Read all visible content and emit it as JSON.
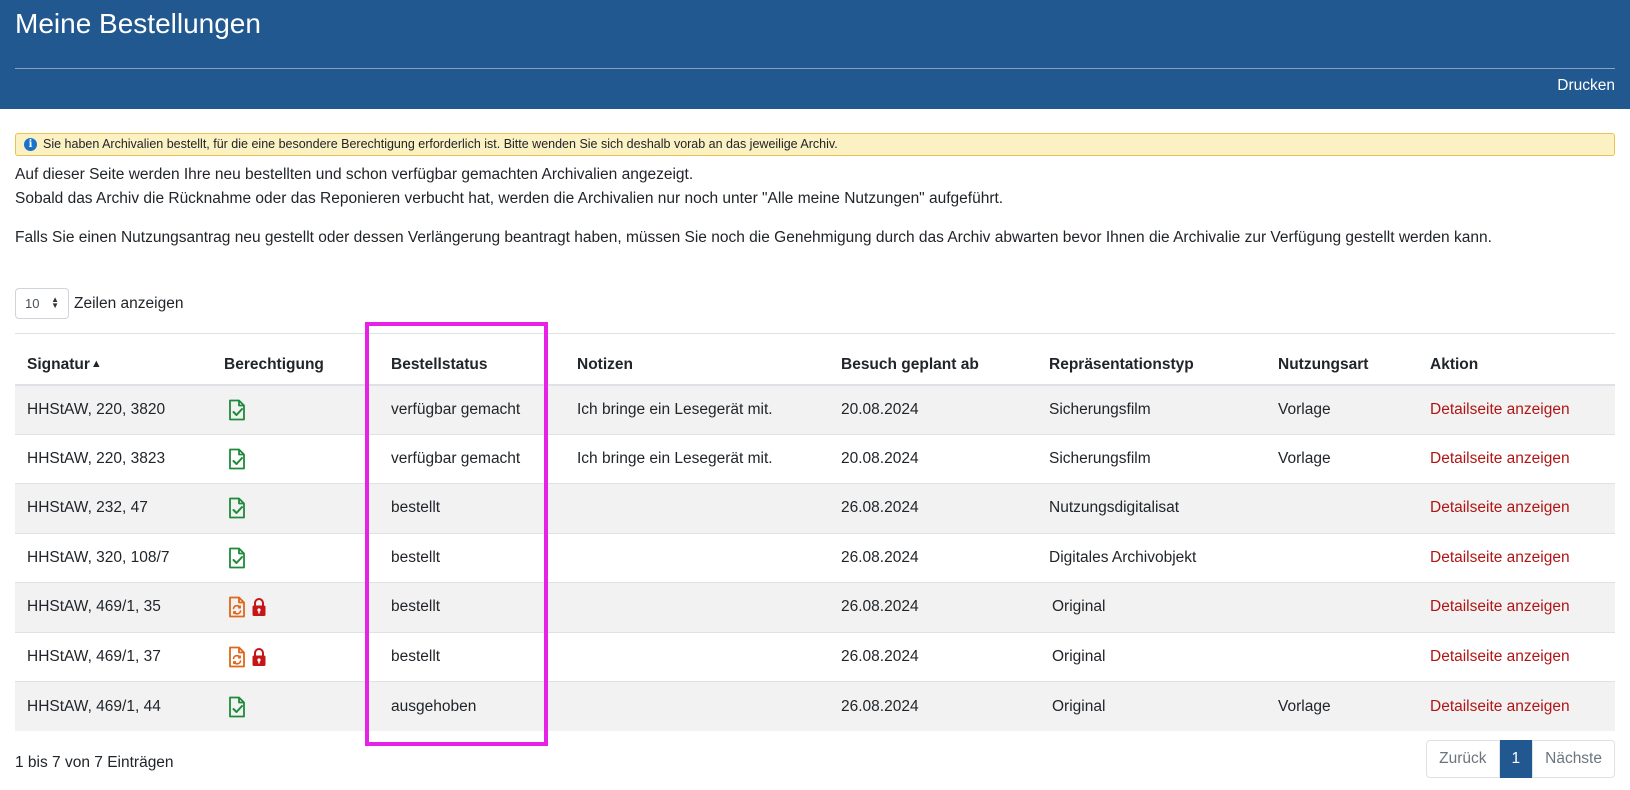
{
  "header": {
    "title": "Meine Bestellungen",
    "print_label": "Drucken",
    "bg_color": "#21588f"
  },
  "alert": {
    "icon": "info-icon",
    "text": "Sie haben Archivalien bestellt, für die eine besondere Berechtigung erforderlich ist. Bitte wenden Sie sich deshalb vorab an das jeweilige Archiv."
  },
  "intro": {
    "line1": "Auf dieser Seite werden Ihre neu bestellten und schon verfügbar gemachten Archivalien angezeigt.",
    "line2": "Sobald das Archiv die Rücknahme oder das Reponieren verbucht hat, werden die Archivalien nur noch unter \"Alle meine Nutzungen\" aufgeführt.",
    "line3": "Falls Sie einen Nutzungsantrag neu gestellt oder dessen Verlängerung beantragt haben, müssen Sie noch die Genehmigung durch das Archiv abwarten bevor Ihnen die Archivalie zur Verfügung gestellt werden kann."
  },
  "length": {
    "selected": "10",
    "label": "Zeilen anzeigen"
  },
  "table": {
    "columns": [
      "Signatur",
      "Berechtigung",
      "Bestellstatus",
      "Notizen",
      "Besuch geplant ab",
      "Repräsentationstyp",
      "Nutzungsart",
      "Aktion"
    ],
    "rows": [
      {
        "signatur": "HHStAW, 220, 3820",
        "berechtigung": "approved",
        "status": "verfügbar gemacht",
        "notizen": "Ich bringe ein Lesegerät mit.",
        "besuch": "20.08.2024",
        "typ": "Sicherungsfilm",
        "nutzungsart": "Vorlage",
        "aktion": "Detailseite anzeigen"
      },
      {
        "signatur": "HHStAW, 220, 3823",
        "berechtigung": "approved",
        "status": "verfügbar gemacht",
        "notizen": "Ich bringe ein Lesegerät mit.",
        "besuch": "20.08.2024",
        "typ": "Sicherungsfilm",
        "nutzungsart": "Vorlage",
        "aktion": "Detailseite anzeigen"
      },
      {
        "signatur": "HHStAW, 232, 47",
        "berechtigung": "approved",
        "status": "bestellt",
        "notizen": "",
        "besuch": "26.08.2024",
        "typ": "Nutzungsdigitalisat",
        "nutzungsart": "",
        "aktion": "Detailseite anzeigen"
      },
      {
        "signatur": "HHStAW, 320, 108/7",
        "berechtigung": "approved",
        "status": "bestellt",
        "notizen": "",
        "besuch": "26.08.2024",
        "typ": "Digitales Archivobjekt",
        "nutzungsart": "",
        "aktion": "Detailseite anzeigen"
      },
      {
        "signatur": "HHStAW, 469/1, 35",
        "berechtigung": "pending-locked",
        "status": "bestellt",
        "notizen": "",
        "besuch": "26.08.2024",
        "typ": "Original",
        "nutzungsart": "",
        "aktion": "Detailseite anzeigen"
      },
      {
        "signatur": "HHStAW, 469/1, 37",
        "berechtigung": "pending-locked",
        "status": "bestellt",
        "notizen": "",
        "besuch": "26.08.2024",
        "typ": "Original",
        "nutzungsart": "",
        "aktion": "Detailseite anzeigen"
      },
      {
        "signatur": "HHStAW, 469/1, 44",
        "berechtigung": "approved",
        "status": "ausgehoben",
        "notizen": "",
        "besuch": "26.08.2024",
        "typ": "Original",
        "nutzungsart": "Vorlage",
        "aktion": "Detailseite anzeigen"
      }
    ]
  },
  "footer": {
    "info": "1 bis 7 von 7 Einträgen",
    "prev": "Zurück",
    "page": "1",
    "next": "Nächste"
  },
  "colors": {
    "link": "#b01515",
    "approved_icon": "#1e8a3a",
    "pending_icon": "#e0661b",
    "lock_icon": "#c41818",
    "highlight": "#e622e6"
  }
}
